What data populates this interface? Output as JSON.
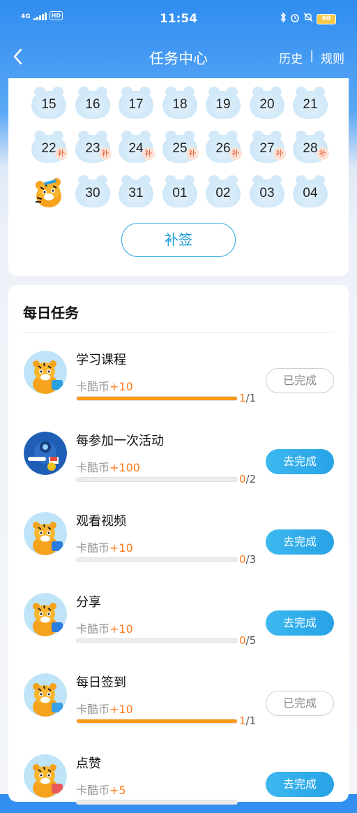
{
  "status_bar": {
    "network": "4G",
    "hd": "HD",
    "time": "11:54",
    "battery": "60"
  },
  "nav": {
    "back_icon": "chevron-left-icon",
    "title": "任务中心",
    "history": "历史",
    "separator": "|",
    "rules": "规则"
  },
  "calendar": {
    "rows": [
      [
        {
          "day": "15"
        },
        {
          "day": "16"
        },
        {
          "day": "17"
        },
        {
          "day": "18"
        },
        {
          "day": "19"
        },
        {
          "day": "20"
        },
        {
          "day": "21"
        }
      ],
      [
        {
          "day": "22",
          "mark": "补"
        },
        {
          "day": "23",
          "mark": "补"
        },
        {
          "day": "24",
          "mark": "补"
        },
        {
          "day": "25",
          "mark": "补"
        },
        {
          "day": "26",
          "mark": "补"
        },
        {
          "day": "27",
          "mark": "补"
        },
        {
          "day": "28",
          "mark": "补"
        }
      ],
      [
        {
          "day": "",
          "tiger": true
        },
        {
          "day": "30"
        },
        {
          "day": "31"
        },
        {
          "day": "01"
        },
        {
          "day": "02"
        },
        {
          "day": "03"
        },
        {
          "day": "04"
        }
      ]
    ],
    "buqian_button": "补签"
  },
  "daily_tasks": {
    "title": "每日任务",
    "reward_prefix": "卡酷币",
    "tasks": [
      {
        "name": "学习课程",
        "reward": "+10",
        "done": "1",
        "total": "/1",
        "progress": 1.0,
        "button": "已完成",
        "status": "finished",
        "icon": "tiger-book-icon"
      },
      {
        "name": "每参加一次活动",
        "reward": "+100",
        "done": "0",
        "total": "/2",
        "progress": 0,
        "button": "去完成",
        "status": "go",
        "icon": "robot-flag-icon"
      },
      {
        "name": "观看视频",
        "reward": "+10",
        "done": "0",
        "total": "/3",
        "progress": 0,
        "button": "去完成",
        "status": "go",
        "icon": "tiger-video-icon"
      },
      {
        "name": "分享",
        "reward": "+10",
        "done": "0",
        "total": "/5",
        "progress": 0,
        "button": "去完成",
        "status": "go",
        "icon": "tiger-share-icon"
      },
      {
        "name": "每日签到",
        "reward": "+10",
        "done": "1",
        "total": "/1",
        "progress": 1.0,
        "button": "已完成",
        "status": "finished",
        "icon": "tiger-calendar-icon"
      },
      {
        "name": "点赞",
        "reward": "+5",
        "done": "",
        "total": "",
        "progress": 0,
        "button": "去完成",
        "status": "go",
        "icon": "tiger-like-icon"
      }
    ]
  }
}
